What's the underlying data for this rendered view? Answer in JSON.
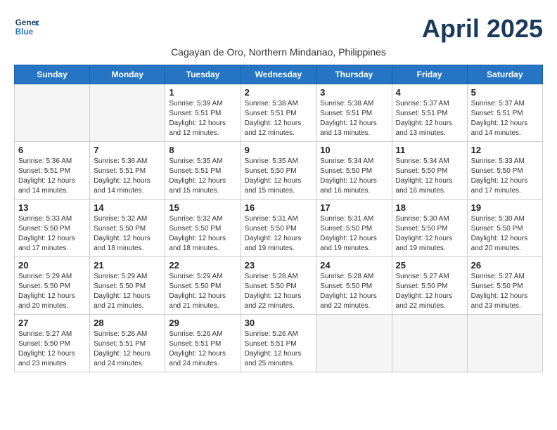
{
  "header": {
    "logo_line1": "General",
    "logo_line2": "Blue",
    "month": "April 2025",
    "subtitle": "Cagayan de Oro, Northern Mindanao, Philippines"
  },
  "days_of_week": [
    "Sunday",
    "Monday",
    "Tuesday",
    "Wednesday",
    "Thursday",
    "Friday",
    "Saturday"
  ],
  "weeks": [
    [
      {
        "day": "",
        "content": ""
      },
      {
        "day": "",
        "content": ""
      },
      {
        "day": "1",
        "content": "Sunrise: 5:39 AM\nSunset: 5:51 PM\nDaylight: 12 hours and 12 minutes."
      },
      {
        "day": "2",
        "content": "Sunrise: 5:38 AM\nSunset: 5:51 PM\nDaylight: 12 hours and 12 minutes."
      },
      {
        "day": "3",
        "content": "Sunrise: 5:38 AM\nSunset: 5:51 PM\nDaylight: 12 hours and 13 minutes."
      },
      {
        "day": "4",
        "content": "Sunrise: 5:37 AM\nSunset: 5:51 PM\nDaylight: 12 hours and 13 minutes."
      },
      {
        "day": "5",
        "content": "Sunrise: 5:37 AM\nSunset: 5:51 PM\nDaylight: 12 hours and 14 minutes."
      }
    ],
    [
      {
        "day": "6",
        "content": "Sunrise: 5:36 AM\nSunset: 5:51 PM\nDaylight: 12 hours and 14 minutes."
      },
      {
        "day": "7",
        "content": "Sunrise: 5:36 AM\nSunset: 5:51 PM\nDaylight: 12 hours and 14 minutes."
      },
      {
        "day": "8",
        "content": "Sunrise: 5:35 AM\nSunset: 5:51 PM\nDaylight: 12 hours and 15 minutes."
      },
      {
        "day": "9",
        "content": "Sunrise: 5:35 AM\nSunset: 5:50 PM\nDaylight: 12 hours and 15 minutes."
      },
      {
        "day": "10",
        "content": "Sunrise: 5:34 AM\nSunset: 5:50 PM\nDaylight: 12 hours and 16 minutes."
      },
      {
        "day": "11",
        "content": "Sunrise: 5:34 AM\nSunset: 5:50 PM\nDaylight: 12 hours and 16 minutes."
      },
      {
        "day": "12",
        "content": "Sunrise: 5:33 AM\nSunset: 5:50 PM\nDaylight: 12 hours and 17 minutes."
      }
    ],
    [
      {
        "day": "13",
        "content": "Sunrise: 5:33 AM\nSunset: 5:50 PM\nDaylight: 12 hours and 17 minutes."
      },
      {
        "day": "14",
        "content": "Sunrise: 5:32 AM\nSunset: 5:50 PM\nDaylight: 12 hours and 18 minutes."
      },
      {
        "day": "15",
        "content": "Sunrise: 5:32 AM\nSunset: 5:50 PM\nDaylight: 12 hours and 18 minutes."
      },
      {
        "day": "16",
        "content": "Sunrise: 5:31 AM\nSunset: 5:50 PM\nDaylight: 12 hours and 19 minutes."
      },
      {
        "day": "17",
        "content": "Sunrise: 5:31 AM\nSunset: 5:50 PM\nDaylight: 12 hours and 19 minutes."
      },
      {
        "day": "18",
        "content": "Sunrise: 5:30 AM\nSunset: 5:50 PM\nDaylight: 12 hours and 19 minutes."
      },
      {
        "day": "19",
        "content": "Sunrise: 5:30 AM\nSunset: 5:50 PM\nDaylight: 12 hours and 20 minutes."
      }
    ],
    [
      {
        "day": "20",
        "content": "Sunrise: 5:29 AM\nSunset: 5:50 PM\nDaylight: 12 hours and 20 minutes."
      },
      {
        "day": "21",
        "content": "Sunrise: 5:29 AM\nSunset: 5:50 PM\nDaylight: 12 hours and 21 minutes."
      },
      {
        "day": "22",
        "content": "Sunrise: 5:29 AM\nSunset: 5:50 PM\nDaylight: 12 hours and 21 minutes."
      },
      {
        "day": "23",
        "content": "Sunrise: 5:28 AM\nSunset: 5:50 PM\nDaylight: 12 hours and 22 minutes."
      },
      {
        "day": "24",
        "content": "Sunrise: 5:28 AM\nSunset: 5:50 PM\nDaylight: 12 hours and 22 minutes."
      },
      {
        "day": "25",
        "content": "Sunrise: 5:27 AM\nSunset: 5:50 PM\nDaylight: 12 hours and 22 minutes."
      },
      {
        "day": "26",
        "content": "Sunrise: 5:27 AM\nSunset: 5:50 PM\nDaylight: 12 hours and 23 minutes."
      }
    ],
    [
      {
        "day": "27",
        "content": "Sunrise: 5:27 AM\nSunset: 5:50 PM\nDaylight: 12 hours and 23 minutes."
      },
      {
        "day": "28",
        "content": "Sunrise: 5:26 AM\nSunset: 5:51 PM\nDaylight: 12 hours and 24 minutes."
      },
      {
        "day": "29",
        "content": "Sunrise: 5:26 AM\nSunset: 5:51 PM\nDaylight: 12 hours and 24 minutes."
      },
      {
        "day": "30",
        "content": "Sunrise: 5:26 AM\nSunset: 5:51 PM\nDaylight: 12 hours and 25 minutes."
      },
      {
        "day": "",
        "content": ""
      },
      {
        "day": "",
        "content": ""
      },
      {
        "day": "",
        "content": ""
      }
    ]
  ]
}
